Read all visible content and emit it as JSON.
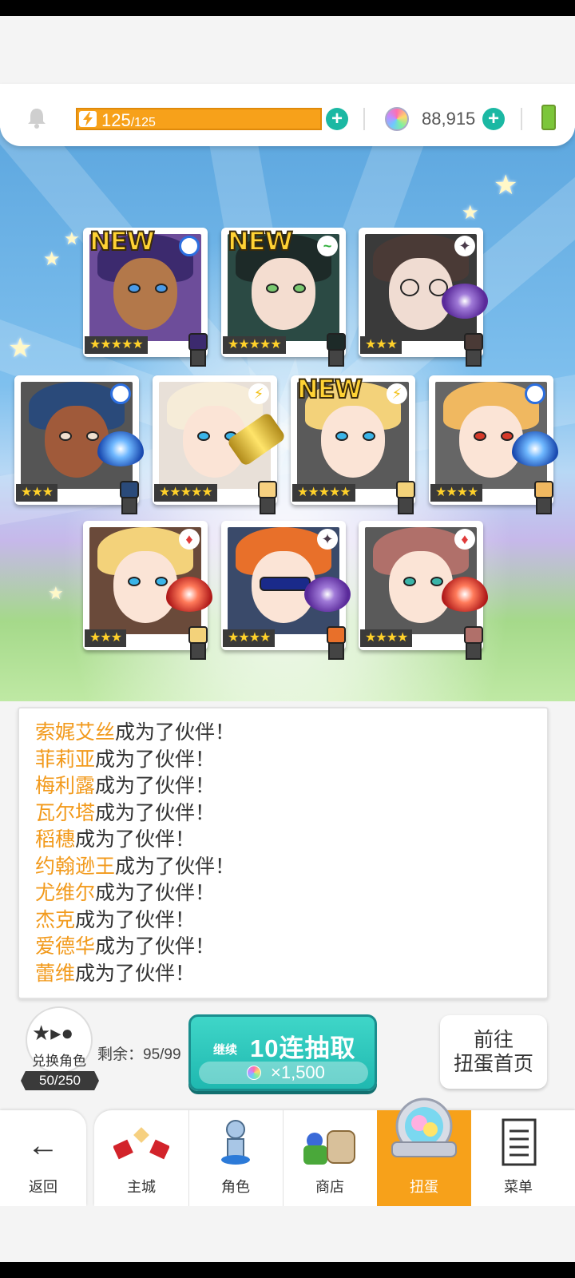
{
  "topbar": {
    "energy_current": "125",
    "energy_max": "/125",
    "gem_count": "88,915"
  },
  "cards": [
    {
      "new": "NEW",
      "stars": "★★★★★",
      "element": "water"
    },
    {
      "new": "NEW",
      "stars": "★★★★★",
      "element": "wind"
    },
    {
      "new": "",
      "stars": "★★★",
      "element": "dark"
    },
    {
      "new": "",
      "stars": "★★★",
      "element": "water"
    },
    {
      "new": "",
      "stars": "★★★★★",
      "element": "lightning"
    },
    {
      "new": "NEW",
      "stars": "★★★★★",
      "element": "lightning"
    },
    {
      "new": "",
      "stars": "★★★★",
      "element": "water"
    },
    {
      "new": "",
      "stars": "★★★",
      "element": "fire"
    },
    {
      "new": "",
      "stars": "★★★★",
      "element": "dark"
    },
    {
      "new": "",
      "stars": "★★★★",
      "element": "fire"
    }
  ],
  "log": {
    "suffix": "成为了伙伴！",
    "names": [
      "索娓艾丝",
      "菲莉亚",
      "梅利露",
      "瓦尔塔",
      "稻穗",
      "约翰逊王",
      "尤维尔",
      "杰克",
      "爱德华",
      "蕾维"
    ]
  },
  "exchange": {
    "label": "兑换角色",
    "count": "50/250"
  },
  "remaining": "剩余：95/99",
  "pull_button": {
    "prefix": "继续",
    "label": "10连抽取",
    "cost": "×1,500"
  },
  "goto_button": {
    "line1": "前往",
    "line2": "扭蛋首页"
  },
  "nav": {
    "back": "返回",
    "items": [
      "主城",
      "角色",
      "商店",
      "扭蛋",
      "菜单"
    ],
    "active": "扭蛋"
  },
  "colors": {
    "accent_orange": "#f7a11a",
    "teal": "#1fb8b0",
    "name_orange": "#f29a1c"
  }
}
